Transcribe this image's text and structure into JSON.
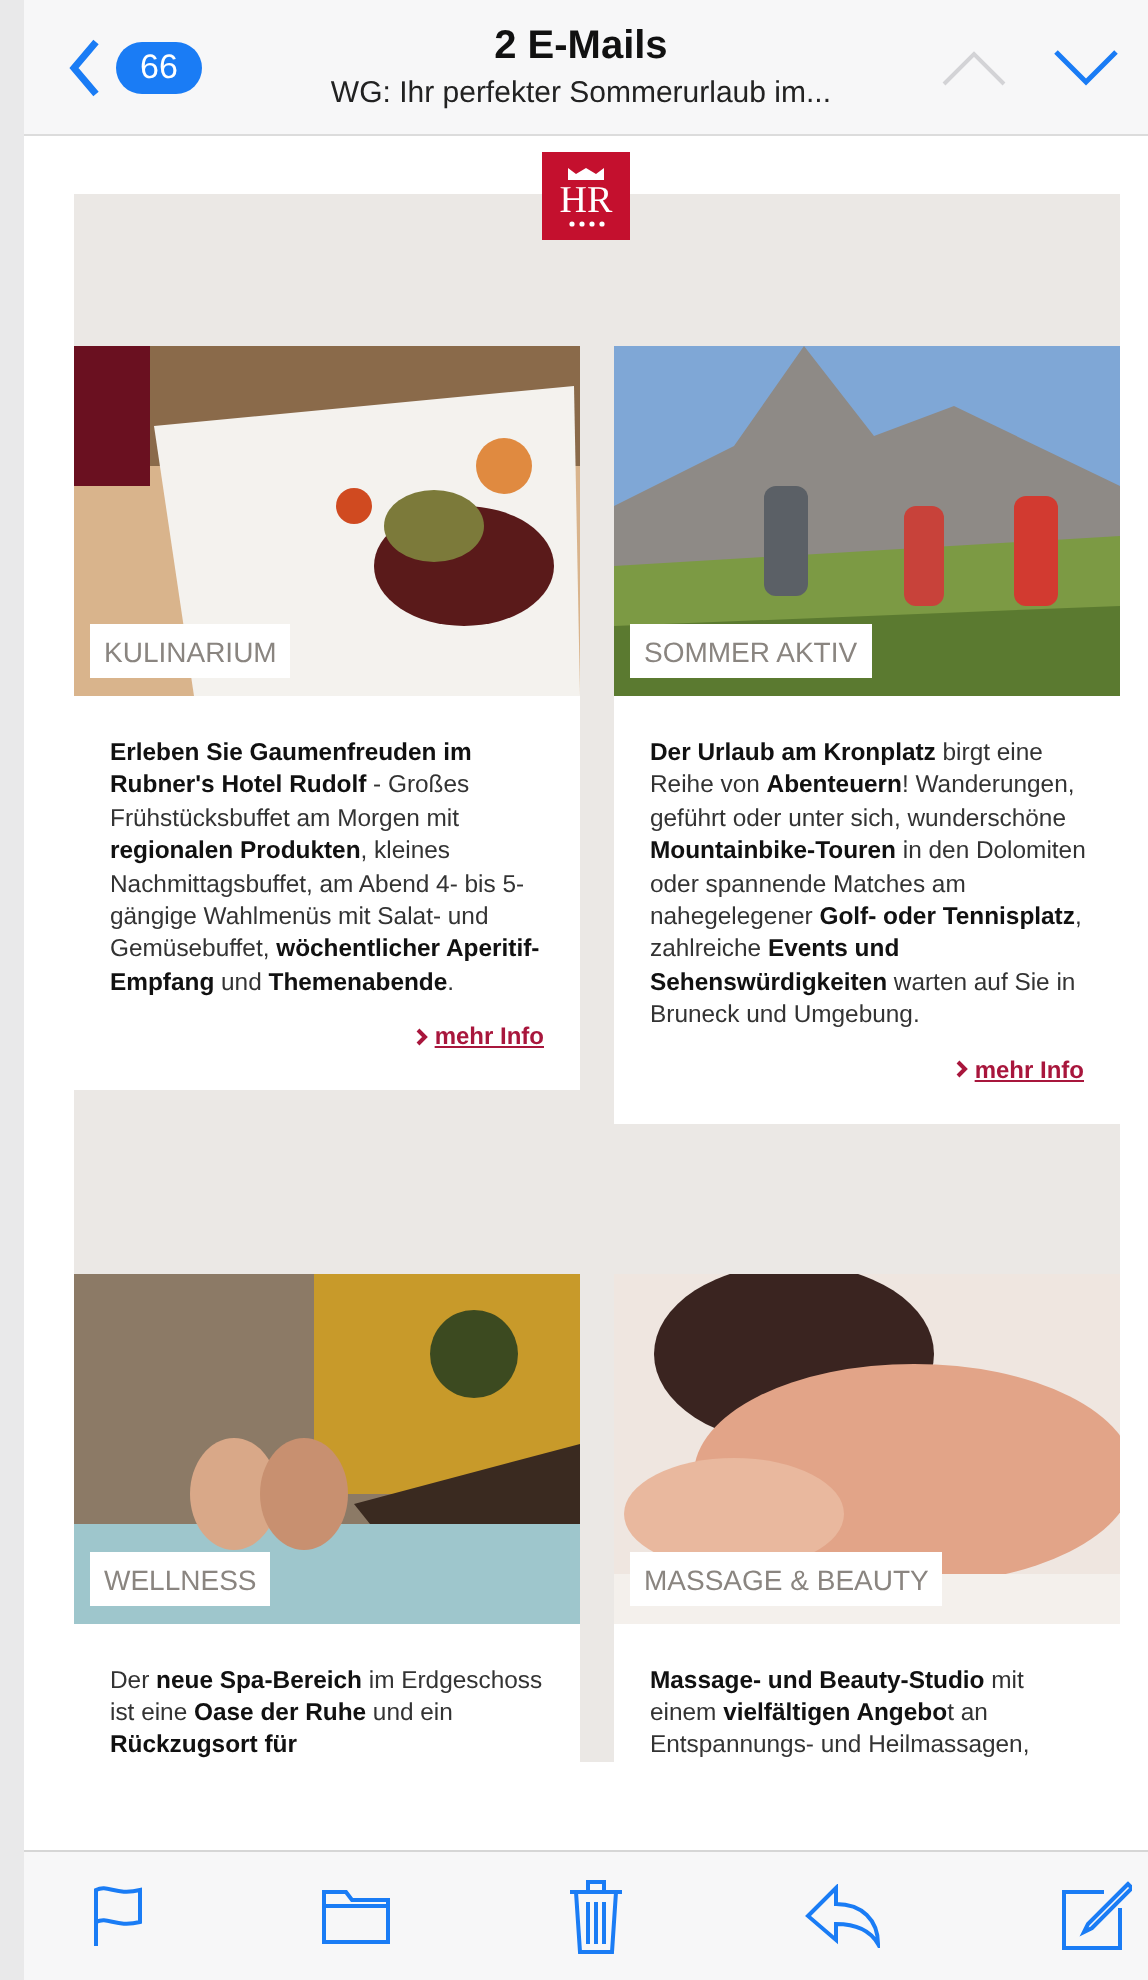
{
  "header": {
    "back_count": "66",
    "title": "2 E-Mails",
    "subtitle": "WG: Ihr perfekter Sommerurlaub im...",
    "previous_enabled": false,
    "next_enabled": true
  },
  "logo": {
    "text": "HR"
  },
  "cards": [
    {
      "label": "KULINARIUM",
      "text": "**Erleben Sie Gaumenfreuden im Rubner's Hotel Rudolf** - Großes Frühstücksbuffet am Morgen mit **regionalen Produkten**, kleines Nachmittagsbuffet, am Abend 4- bis 5-gängige Wahlmenüs mit Salat- und Gemüsebuffet, **wöchentlicher Aperitif-Empfang** und **Themenabende**.",
      "link": "mehr Info"
    },
    {
      "label": "SOMMER AKTIV",
      "text": "**Der Urlaub am Kronplatz** birgt eine Reihe von **Abenteuern**! Wanderungen, geführt oder unter sich, wunderschöne **Mountainbike-Touren** in den Dolomiten oder spannende Matches am nahegelegener **Golf- oder Tennisplatz**, zahlreiche **Events und Sehenswürdigkeiten** warten auf Sie in Bruneck und Umgebung.",
      "link": "mehr Info"
    },
    {
      "label": "WELLNESS",
      "text": "Der **neue Spa-Bereich** im Erdgeschoss ist eine **Oase der Ruhe** und ein **Rückzugsort für**"
    },
    {
      "label": "MASSAGE & BEAUTY",
      "text": "**Massage- und Beauty-Studio** mit einem **vielfältigen Angebo**t an Entspannungs- und Heilmassagen,"
    }
  ],
  "toolbar": [
    {
      "kind": "flag"
    },
    {
      "kind": "folder"
    },
    {
      "kind": "trash"
    },
    {
      "kind": "reply"
    },
    {
      "kind": "compose"
    }
  ]
}
